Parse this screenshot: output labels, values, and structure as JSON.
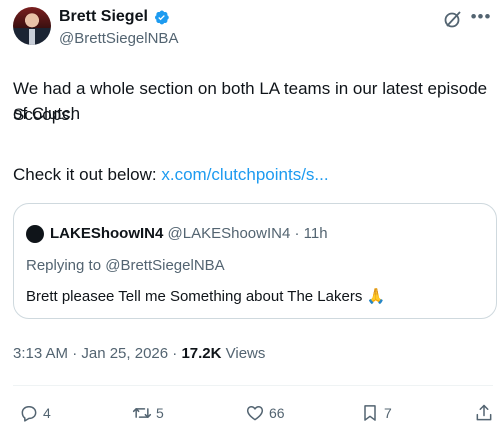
{
  "author": {
    "name": "Brett Siegel",
    "handle": "@BrettSiegelNBA"
  },
  "post": {
    "line1": "We had a whole section on both LA teams in our latest episode of Clutch",
    "line2": "Scoops.",
    "line3_prefix": "Check it out below: ",
    "link_text": "x.com/clutchpoints/s..."
  },
  "quote": {
    "name": "LAKEShoowIN4",
    "meta": " @LAKEShoowIN4 · 11h",
    "replying_to": "Replying to @BrettSiegelNBA",
    "text": "Brett pleasee Tell me Something about The Lakers 🙏"
  },
  "meta": {
    "timestamp": "3:13 AM · Jan 25, 2026 · ",
    "views_count": "17.2K",
    "views_label": " Views"
  },
  "actions": {
    "replies": "4",
    "retweets": "5",
    "likes": "66",
    "bookmarks": "7"
  },
  "colors": {
    "link": "#1d9bf0",
    "verified": "#1d9bf0",
    "secondary_text": "#536471",
    "primary_text": "#0f1419"
  }
}
